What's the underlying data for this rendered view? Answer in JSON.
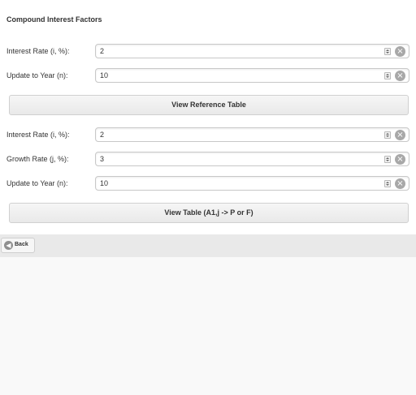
{
  "page": {
    "title": "Compound Interest Factors"
  },
  "section1": {
    "interest_rate": {
      "label": "Interest Rate (i, %):",
      "value": "2"
    },
    "update_year": {
      "label": "Update to Year (n):",
      "value": "10"
    },
    "button_label": "View Reference Table"
  },
  "section2": {
    "interest_rate": {
      "label": "Interest Rate (i, %):",
      "value": "2"
    },
    "growth_rate": {
      "label": "Growth Rate (j, %):",
      "value": "3"
    },
    "update_year": {
      "label": "Update to Year (n):",
      "value": "10"
    },
    "button_label": "View Table (A1,j -> P or F)"
  },
  "footer": {
    "back_label": "Back"
  },
  "icons": {
    "spinner": "stepper-icon",
    "clear": "clear-circle-icon",
    "back": "back-arrow-icon"
  }
}
